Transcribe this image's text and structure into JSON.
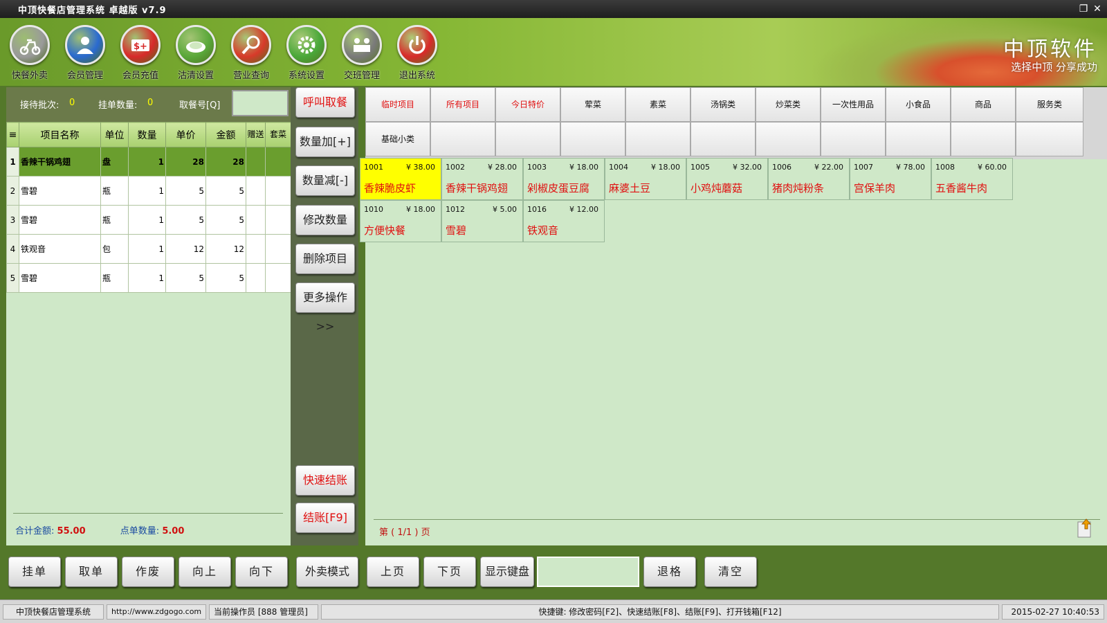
{
  "window": {
    "title": "中顶快餐店管理系统 卓越版 v7.9"
  },
  "toolbar": {
    "buttons": [
      {
        "label": "快餐外卖",
        "icon": "scooter-icon",
        "color": "#9a9a9a"
      },
      {
        "label": "会员管理",
        "icon": "member-icon",
        "color": "#2a6ad0"
      },
      {
        "label": "会员充值",
        "icon": "recharge-icon",
        "color": "#d82a2a"
      },
      {
        "label": "沽清设置",
        "icon": "plate-icon",
        "color": "#5aa83a"
      },
      {
        "label": "营业查询",
        "icon": "magnifier-icon",
        "color": "#d83a2a"
      },
      {
        "label": "系统设置",
        "icon": "gear-icon",
        "color": "#4aa83a"
      },
      {
        "label": "交班管理",
        "icon": "handover-icon",
        "color": "#7a7a7a"
      },
      {
        "label": "退出系统",
        "icon": "power-icon",
        "color": "#d82a2a"
      }
    ],
    "banner_title": "中顶软件",
    "banner_subtitle": "选择中顶 分享成功"
  },
  "infobar": {
    "waiting_label": "接待批次:",
    "waiting_value": "0",
    "hold_label": "挂单数量:",
    "hold_value": "0",
    "pickup_label": "取餐号[Q]",
    "pickup_value": ""
  },
  "order_table": {
    "headers": [
      "≡",
      "项目名称",
      "单位",
      "数量",
      "单价",
      "金额",
      "赠送",
      "套菜"
    ],
    "rows": [
      {
        "idx": "1",
        "name": "香辣干锅鸡翅",
        "unit": "盘",
        "qty": "1",
        "price": "28",
        "amount": "28",
        "gift": "",
        "set": ""
      },
      {
        "idx": "2",
        "name": "雪碧",
        "unit": "瓶",
        "qty": "1",
        "price": "5",
        "amount": "5",
        "gift": "",
        "set": ""
      },
      {
        "idx": "3",
        "name": "雪碧",
        "unit": "瓶",
        "qty": "1",
        "price": "5",
        "amount": "5",
        "gift": "",
        "set": ""
      },
      {
        "idx": "4",
        "name": "铁观音",
        "unit": "包",
        "qty": "1",
        "price": "12",
        "amount": "12",
        "gift": "",
        "set": ""
      },
      {
        "idx": "5",
        "name": "雪碧",
        "unit": "瓶",
        "qty": "1",
        "price": "5",
        "amount": "5",
        "gift": "",
        "set": ""
      }
    ],
    "selected_row": 0,
    "total_label": "合计金额:",
    "total_value": "55.00",
    "count_label": "点单数量:",
    "count_value": "5.00"
  },
  "middle_buttons": {
    "call": "呼叫取餐",
    "qty_plus": "数量加[+]",
    "qty_minus": "数量减[-]",
    "edit_qty": "修改数量",
    "delete": "删除项目",
    "more": "更多操作>>",
    "quick_checkout": "快速结账",
    "checkout": "结账[F9]"
  },
  "categories": {
    "row1": [
      "临时项目",
      "所有项目",
      "今日特价",
      "荤菜",
      "素菜",
      "汤锅类",
      "炒菜类",
      "一次性用品",
      "小食品",
      "商品",
      "服务类"
    ],
    "row2": [
      "基础小类"
    ],
    "red_count": 3
  },
  "items": [
    {
      "code": "1001",
      "price": "¥ 38.00",
      "name": "香辣脆皮虾",
      "selected": true
    },
    {
      "code": "1002",
      "price": "¥ 28.00",
      "name": "香辣干锅鸡翅",
      "selected": false
    },
    {
      "code": "1003",
      "price": "¥ 18.00",
      "name": "剁椒皮蛋豆腐",
      "selected": false
    },
    {
      "code": "1004",
      "price": "¥ 18.00",
      "name": "麻婆土豆",
      "selected": false
    },
    {
      "code": "1005",
      "price": "¥ 32.00",
      "name": "小鸡炖蘑菇",
      "selected": false
    },
    {
      "code": "1006",
      "price": "¥ 22.00",
      "name": "猪肉炖粉条",
      "selected": false
    },
    {
      "code": "1007",
      "price": "¥ 78.00",
      "name": "宫保羊肉",
      "selected": false
    },
    {
      "code": "1008",
      "price": "¥ 60.00",
      "name": "五香酱牛肉",
      "selected": false
    },
    {
      "code": "1010",
      "price": "¥ 18.00",
      "name": "方便快餐",
      "selected": false
    },
    {
      "code": "1012",
      "price": "¥ 5.00",
      "name": "雪碧",
      "selected": false
    },
    {
      "code": "1016",
      "price": "¥ 12.00",
      "name": "铁观音",
      "selected": false
    }
  ],
  "pager": {
    "text": "第 ( 1/1 ) 页"
  },
  "bottom_buttons": {
    "hold": "挂单",
    "take": "取单",
    "void": "作废",
    "up": "向上",
    "down": "向下",
    "takeout_mode": "外卖模式",
    "prev_page": "上页",
    "next_page": "下页",
    "show_keyboard": "显示键盘",
    "input_value": "",
    "backspace": "退格",
    "clear": "清空"
  },
  "statusbar": {
    "app": "中顶快餐店管理系统",
    "url": "http://www.zdgogo.com",
    "operator": "当前操作员 [888 管理员]",
    "shortcuts": "快捷键: 修改密码[F2]、快速结账[F8]、结账[F9]、打开钱箱[F12]",
    "datetime": "2015-02-27 10:40:53"
  },
  "colors": {
    "accent_green": "#6a9e2e",
    "highlight_yellow": "#ffff00",
    "text_red": "#e01010",
    "panel_bg": "#cfe8c8"
  }
}
